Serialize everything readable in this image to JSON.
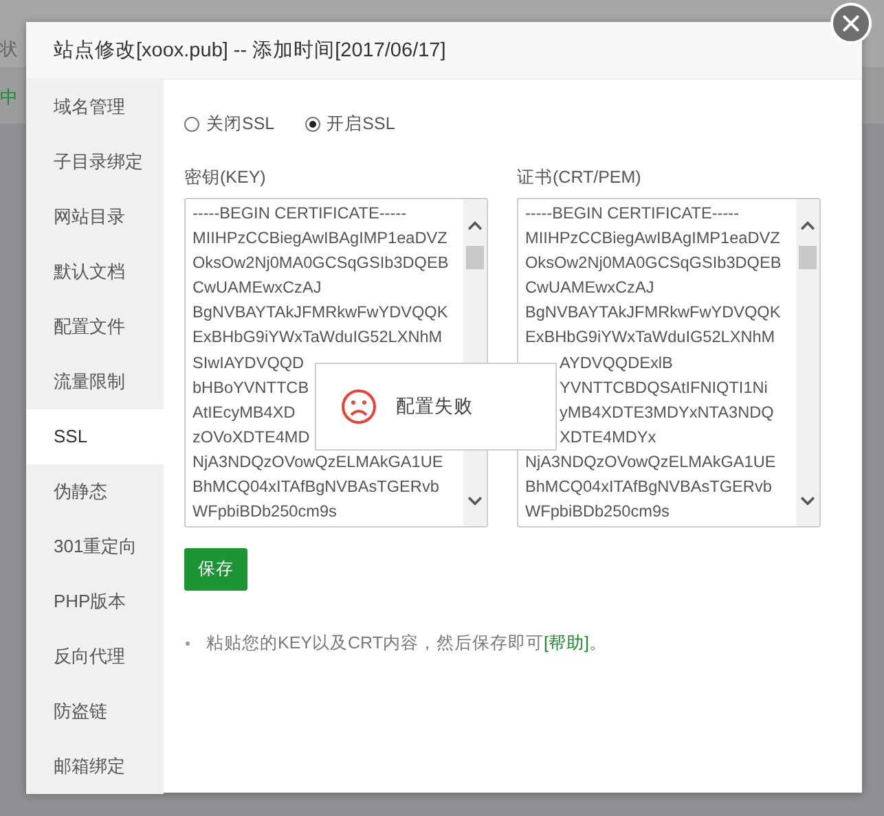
{
  "background_page": {
    "header_fragment": "状",
    "row_fragment": "中"
  },
  "dialog": {
    "title": "站点修改[xoox.pub] -- 添加时间[2017/06/17]"
  },
  "sidebar": {
    "items": [
      {
        "label": "域名管理",
        "selected": false
      },
      {
        "label": "子目录绑定",
        "selected": false
      },
      {
        "label": "网站目录",
        "selected": false
      },
      {
        "label": "默认文档",
        "selected": false
      },
      {
        "label": "配置文件",
        "selected": false
      },
      {
        "label": "流量限制",
        "selected": false
      },
      {
        "label": "SSL",
        "selected": true
      },
      {
        "label": "伪静态",
        "selected": false
      },
      {
        "label": "301重定向",
        "selected": false
      },
      {
        "label": "PHP版本",
        "selected": false
      },
      {
        "label": "反向代理",
        "selected": false
      },
      {
        "label": "防盗链",
        "selected": false
      },
      {
        "label": "邮箱绑定",
        "selected": false
      }
    ]
  },
  "ssl_options": [
    {
      "label": "关闭SSL",
      "selected": false
    },
    {
      "label": "开启SSL",
      "selected": true
    }
  ],
  "key_field": {
    "label": "密钥(KEY)",
    "lines": [
      {
        "text": "-----BEGIN CERTIFICATE-----",
        "kind": "full"
      },
      {
        "text": "MIIHPzCCBiegAwIBAgIMP1eaDVZ",
        "kind": "full"
      },
      {
        "text": "OksOw2Nj0MA0GCSqGSIb3DQEB",
        "kind": "full"
      },
      {
        "text": "CwUAMEwxCzAJ",
        "kind": "full"
      },
      {
        "text": "BgNVBAYTAkJFMRkwFwYDVQQK",
        "kind": "full"
      },
      {
        "text": "ExBHbG9iYWxTaWduIG52LXNhM",
        "kind": "full"
      },
      {
        "text": "SIwIAYDVQQD",
        "kind": "full"
      },
      {
        "text": "bHBoYVNTTCB",
        "kind": "full"
      },
      {
        "text": "AtIEcyMB4XD",
        "kind": "full"
      },
      {
        "text": "zOVoXDTE4MD",
        "kind": "full"
      },
      {
        "text": "NjA3NDQzOVowQzELMAkGA1UE",
        "kind": "full"
      },
      {
        "text": "BhMCQ04xITAfBgNVBAsTGERvb",
        "kind": "full"
      },
      {
        "text": "WFpbiBDb250cm9s",
        "kind": "full"
      }
    ]
  },
  "cert_field": {
    "label": "证书(CRT/PEM)",
    "lines": [
      {
        "text": "-----BEGIN CERTIFICATE-----",
        "kind": "full"
      },
      {
        "text": "MIIHPzCCBiegAwIBAgIMP1eaDVZ",
        "kind": "full"
      },
      {
        "text": "OksOw2Nj0MA0GCSqGSIb3DQEB",
        "kind": "full"
      },
      {
        "text": "CwUAMEwxCzAJ",
        "kind": "full"
      },
      {
        "text": "BgNVBAYTAkJFMRkwFwYDVQQK",
        "kind": "full"
      },
      {
        "text": "ExBHbG9iYWxTaWduIG52LXNhM",
        "kind": "full"
      },
      {
        "text": "AYDVQQDExlB",
        "kind": "tail"
      },
      {
        "text": "YVNTTCBDQSAtIFNIQTI1Ni",
        "kind": "tail"
      },
      {
        "text": "yMB4XDTE3MDYxNTA3NDQ",
        "kind": "tail"
      },
      {
        "text": "XDTE4MDYx",
        "kind": "tail"
      },
      {
        "text": "NjA3NDQzOVowQzELMAkGA1UE",
        "kind": "full"
      },
      {
        "text": "BhMCQ04xITAfBgNVBAsTGERvb",
        "kind": "full"
      },
      {
        "text": "WFpbiBDb250cm9s",
        "kind": "full"
      }
    ]
  },
  "save_button": "保存",
  "note": {
    "text": "粘贴您的KEY以及CRT内容，然后保存即可",
    "link": "[帮助]",
    "end": "。"
  },
  "toast": {
    "message": "配置失败"
  }
}
